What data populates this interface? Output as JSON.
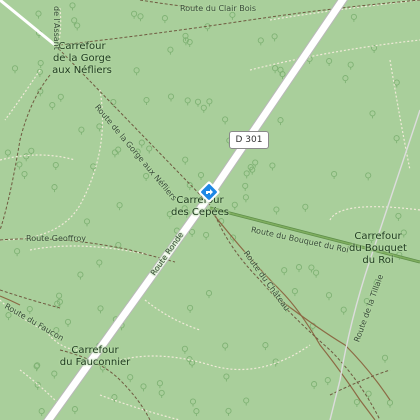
{
  "places": {
    "gorge": [
      "Carrefour",
      "de la Gorge",
      "aux Néfliers"
    ],
    "cepees": [
      "Carrefour",
      "des Cepées"
    ],
    "bouquet": [
      "Carrefour",
      "du Bouquet",
      "du Roi"
    ],
    "fauconnier": [
      "Carrefour",
      "du Fauconnier"
    ]
  },
  "roads": {
    "clair_bois": "Route du Clair Bois",
    "gorge_nefliers": "Route de la Gorge aux Néfliers",
    "ronde": "Route Ronde",
    "bouquet_roi": "Route du Bouquet du Roi",
    "chateau": "Route du Château",
    "geoffroy": "Route Geoffroy",
    "faucon": "Route du Faucon",
    "tillaie": "Route de la Tillaie",
    "assant": "de l'Assant"
  },
  "shield": {
    "label": "D 301"
  },
  "marker": {
    "icon": "directions-diamond-icon",
    "color": "#1e88e5"
  },
  "colors": {
    "forest": "#a9cf9b",
    "main_road": "#ffffff",
    "road_casing": "#c8c8c8",
    "track": "#8a6a4a",
    "path": "#e8e0d0",
    "tree": "#7fb274"
  }
}
